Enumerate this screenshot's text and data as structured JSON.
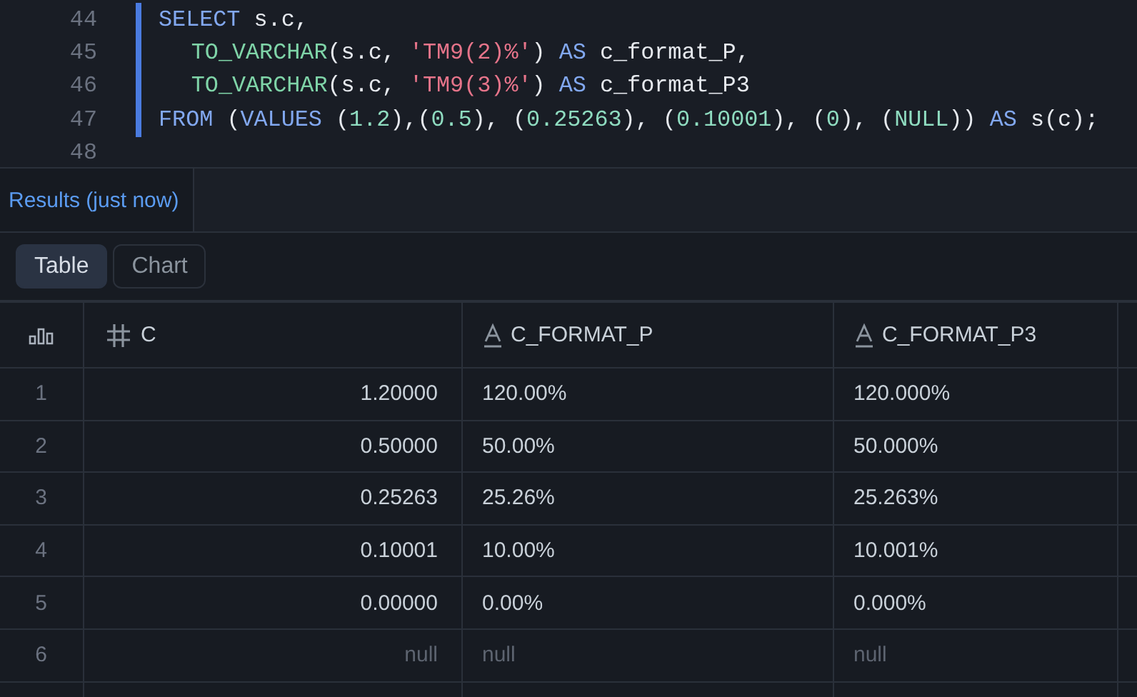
{
  "editor": {
    "lines": [
      {
        "number": "44",
        "tokens": [
          {
            "kind": "keyword",
            "text": "SELECT"
          },
          {
            "kind": "plain",
            "text": " s.c,"
          }
        ]
      },
      {
        "number": "45",
        "indented": true,
        "tokens": [
          {
            "kind": "function",
            "text": "TO_VARCHAR"
          },
          {
            "kind": "plain",
            "text": "(s.c, "
          },
          {
            "kind": "string",
            "text": "'TM9(2)%'"
          },
          {
            "kind": "plain",
            "text": ") "
          },
          {
            "kind": "keyword",
            "text": "AS"
          },
          {
            "kind": "plain",
            "text": " c_format_P,"
          }
        ]
      },
      {
        "number": "46",
        "indented": true,
        "tokens": [
          {
            "kind": "function",
            "text": "TO_VARCHAR"
          },
          {
            "kind": "plain",
            "text": "(s.c, "
          },
          {
            "kind": "string",
            "text": "'TM9(3)%'"
          },
          {
            "kind": "plain",
            "text": ") "
          },
          {
            "kind": "keyword",
            "text": "AS"
          },
          {
            "kind": "plain",
            "text": " c_format_P3"
          }
        ]
      },
      {
        "number": "47",
        "tokens": [
          {
            "kind": "keyword",
            "text": "FROM"
          },
          {
            "kind": "plain",
            "text": " ("
          },
          {
            "kind": "keyword",
            "text": "VALUES"
          },
          {
            "kind": "plain",
            "text": " ("
          },
          {
            "kind": "number",
            "text": "1.2"
          },
          {
            "kind": "plain",
            "text": "),("
          },
          {
            "kind": "number",
            "text": "0.5"
          },
          {
            "kind": "plain",
            "text": "), ("
          },
          {
            "kind": "number",
            "text": "0.25263"
          },
          {
            "kind": "plain",
            "text": "), ("
          },
          {
            "kind": "number",
            "text": "0.10001"
          },
          {
            "kind": "plain",
            "text": "), ("
          },
          {
            "kind": "number",
            "text": "0"
          },
          {
            "kind": "plain",
            "text": "), ("
          },
          {
            "kind": "number",
            "text": "NULL"
          },
          {
            "kind": "plain",
            "text": ")) "
          },
          {
            "kind": "keyword",
            "text": "AS"
          },
          {
            "kind": "plain",
            "text": " s(c);"
          }
        ]
      },
      {
        "number": "48"
      }
    ]
  },
  "results_tabs": [
    {
      "label": "Results (just now)",
      "selected": true
    }
  ],
  "view_toggle": [
    {
      "label": "Table",
      "selected": true
    },
    {
      "label": "Chart",
      "selected": false
    }
  ],
  "table": {
    "columns": [
      {
        "label": "C",
        "kind": "number"
      },
      {
        "label": "C_FORMAT_P",
        "kind": "text"
      },
      {
        "label": "C_FORMAT_P3",
        "kind": "text"
      }
    ],
    "rows": [
      {
        "index": "1",
        "cells": [
          "1.20000",
          "120.00%",
          "120.000%"
        ],
        "null": false
      },
      {
        "index": "2",
        "cells": [
          "0.50000",
          "50.00%",
          "50.000%"
        ],
        "null": false
      },
      {
        "index": "3",
        "cells": [
          "0.25263",
          "25.26%",
          "25.263%"
        ],
        "null": false
      },
      {
        "index": "4",
        "cells": [
          "0.10001",
          "10.00%",
          "10.001%"
        ],
        "null": false
      },
      {
        "index": "5",
        "cells": [
          "0.00000",
          "0.00%",
          "0.000%"
        ],
        "null": false
      },
      {
        "index": "6",
        "cells": [
          "null",
          "null",
          "null"
        ],
        "null": true
      }
    ]
  }
}
